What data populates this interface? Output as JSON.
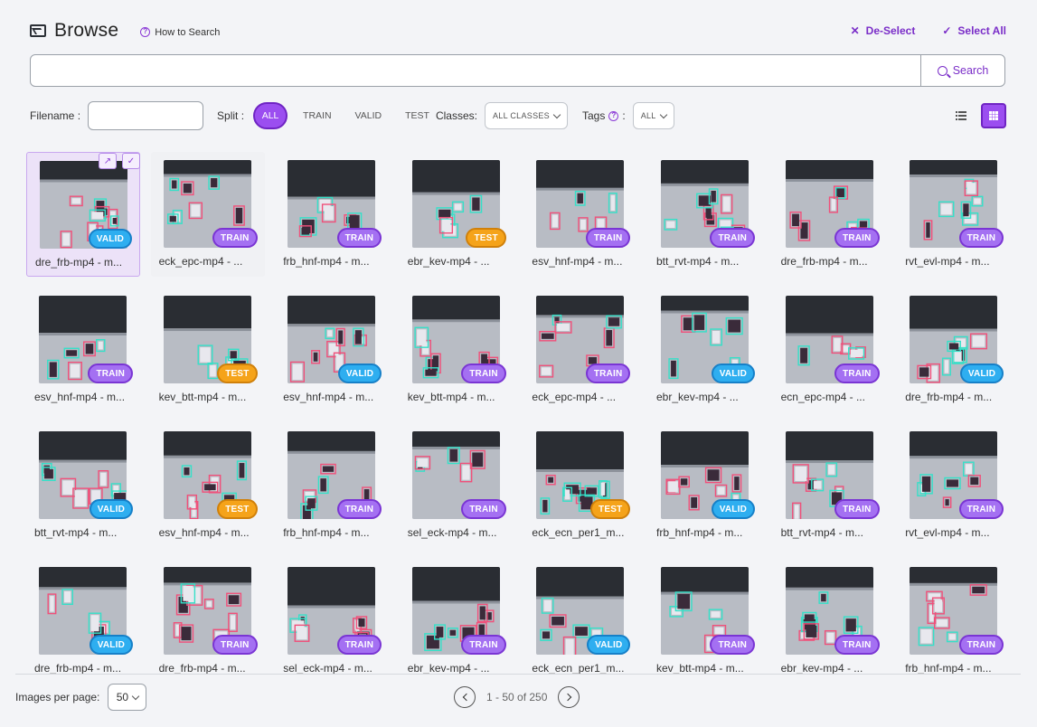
{
  "header": {
    "title": "Browse",
    "how_to": "How to Search",
    "deselect": "De-Select",
    "select_all": "Select All",
    "icons": [
      "image-icon",
      "help-icon",
      "close-icon",
      "check-icon"
    ]
  },
  "search": {
    "button_label": "Search",
    "value": "",
    "placeholder": ""
  },
  "filters": {
    "filename_label": "Filename :",
    "filename_value": "",
    "split_label": "Split :",
    "split_options": [
      "ALL",
      "TRAIN",
      "VALID",
      "TEST"
    ],
    "split_selected": "ALL",
    "classes_label": "Classes:",
    "classes_value": "ALL CLASSES",
    "tags_label": "Tags",
    "tags_value": "ALL"
  },
  "colors": {
    "accent": "#9b4ef0",
    "train": "#a470f2",
    "valid": "#2eaef0",
    "test": "#f5a31a",
    "box_teal": "#35e0c8",
    "box_pink": "#f0507a"
  },
  "images": [
    {
      "name": "dre_frb-mp4 - m...",
      "split": "VALID"
    },
    {
      "name": "eck_epc-mp4 - ...",
      "split": "TRAIN"
    },
    {
      "name": "frb_hnf-mp4 - m...",
      "split": "TRAIN"
    },
    {
      "name": "ebr_kev-mp4 - ...",
      "split": "TEST"
    },
    {
      "name": "esv_hnf-mp4 - m...",
      "split": "TRAIN"
    },
    {
      "name": "btt_rvt-mp4 - m...",
      "split": "TRAIN"
    },
    {
      "name": "dre_frb-mp4 - m...",
      "split": "TRAIN"
    },
    {
      "name": "rvt_evl-mp4 - m...",
      "split": "TRAIN"
    },
    {
      "name": "esv_hnf-mp4 - m...",
      "split": "TRAIN"
    },
    {
      "name": "kev_btt-mp4 - m...",
      "split": "TEST"
    },
    {
      "name": "esv_hnf-mp4 - m...",
      "split": "VALID"
    },
    {
      "name": "kev_btt-mp4 - m...",
      "split": "TRAIN"
    },
    {
      "name": "eck_epc-mp4 - ...",
      "split": "TRAIN"
    },
    {
      "name": "ebr_kev-mp4 - ...",
      "split": "VALID"
    },
    {
      "name": "ecn_epc-mp4 - ...",
      "split": "TRAIN"
    },
    {
      "name": "dre_frb-mp4 - m...",
      "split": "VALID"
    },
    {
      "name": "btt_rvt-mp4 - m...",
      "split": "VALID"
    },
    {
      "name": "esv_hnf-mp4 - m...",
      "split": "TEST"
    },
    {
      "name": "frb_hnf-mp4 - m...",
      "split": "TRAIN"
    },
    {
      "name": "sel_eck-mp4 - m...",
      "split": "TRAIN"
    },
    {
      "name": "eck_ecn_per1_m...",
      "split": "TEST"
    },
    {
      "name": "frb_hnf-mp4 - m...",
      "split": "VALID"
    },
    {
      "name": "btt_rvt-mp4 - m...",
      "split": "TRAIN"
    },
    {
      "name": "rvt_evl-mp4 - m...",
      "split": "TRAIN"
    },
    {
      "name": "dre_frb-mp4 - m...",
      "split": "VALID"
    },
    {
      "name": "dre_frb-mp4 - m...",
      "split": "TRAIN"
    },
    {
      "name": "sel_eck-mp4 - m...",
      "split": "TRAIN"
    },
    {
      "name": "ebr_kev-mp4 - ...",
      "split": "TRAIN"
    },
    {
      "name": "eck_ecn_per1_m...",
      "split": "VALID"
    },
    {
      "name": "kev_btt-mp4 - m...",
      "split": "TRAIN"
    },
    {
      "name": "ebr_kev-mp4 - ...",
      "split": "TRAIN"
    },
    {
      "name": "frb_hnf-mp4 - m...",
      "split": "TRAIN"
    }
  ],
  "selected_index": 0,
  "hover_index": 1,
  "footer": {
    "per_page_label": "Images per page:",
    "per_page_value": "50",
    "range": "1 - 50 of 250"
  }
}
